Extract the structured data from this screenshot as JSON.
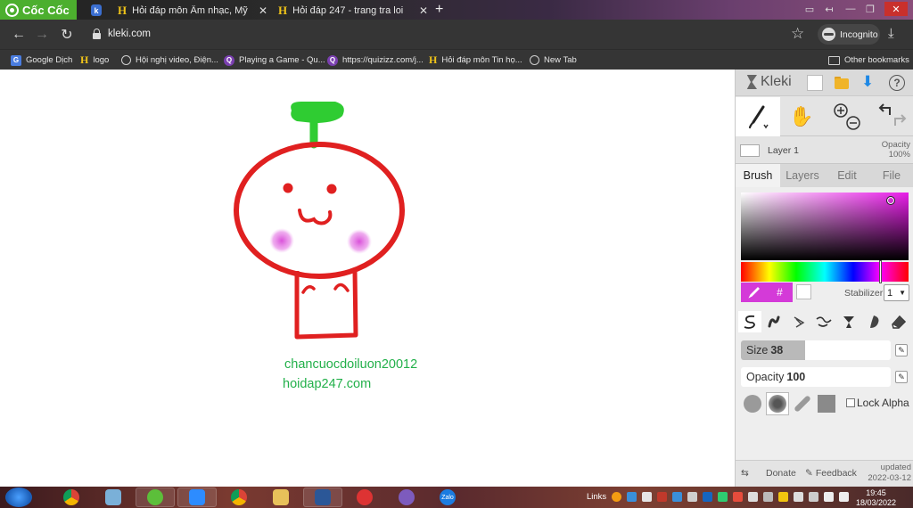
{
  "browser": {
    "brand": "Cốc Cốc",
    "tabs": [
      {
        "title": "Hỏi đáp môn Âm nhạc, Mỹ th",
        "favicon": "h-icon"
      },
      {
        "title": "Hỏi đáp 247 - trang tra loi",
        "favicon": "h-icon"
      }
    ],
    "new_tab_glyph": "+",
    "window_controls": {
      "minimize": "—",
      "maximize": "❐",
      "close": "✕"
    },
    "address": "kleki.com",
    "incognito_label": "Incognito",
    "bookmarks": [
      {
        "label": "Google Dịch",
        "icon": "translate-icon"
      },
      {
        "label": "logo",
        "icon": "h-icon"
      },
      {
        "label": "Hội nghị video, Điện...",
        "icon": "globe-icon"
      },
      {
        "label": "Playing a Game - Qu...",
        "icon": "quizizz-icon"
      },
      {
        "label": "https://quizizz.com/j...",
        "icon": "quizizz-icon"
      },
      {
        "label": "Hỏi đáp môn Tin họ...",
        "icon": "h-icon"
      },
      {
        "label": "New Tab",
        "icon": "globe-icon"
      }
    ],
    "other_bookmarks": "Other bookmarks"
  },
  "canvas": {
    "signature_line1": "chancuocdoiluon20012",
    "signature_line2": "hoidap247.com",
    "colors": {
      "head": "#e02020",
      "leaf": "#2fcc32",
      "cheek": "#e070e0",
      "text": "#22b04a"
    }
  },
  "kleki": {
    "app_name": "Kleki",
    "help_glyph": "?",
    "layer_name": "Layer 1",
    "opacity_label": "Opacity",
    "opacity_value": "100%",
    "tabs": [
      "Brush",
      "Layers",
      "Edit",
      "File"
    ],
    "active_tab": "Brush",
    "color_hash": "#",
    "stabilizer_label": "Stabilizer",
    "stabilizer_value": "1",
    "size_label": "Size",
    "size_value": "38",
    "size_fraction": 0.43,
    "opacity_slider_label": "Opacity",
    "opacity_slider_value": "100",
    "lock_alpha": "Lock Alpha",
    "footer": {
      "donate": "Donate",
      "feedback": "Feedback",
      "updated_label": "updated",
      "updated_date": "2022-03-12"
    },
    "primary_color": "#d43ad8"
  },
  "taskbar": {
    "links_label": "Links",
    "time": "19:45",
    "date": "18/03/2022",
    "zalo_label": "Zalo"
  }
}
